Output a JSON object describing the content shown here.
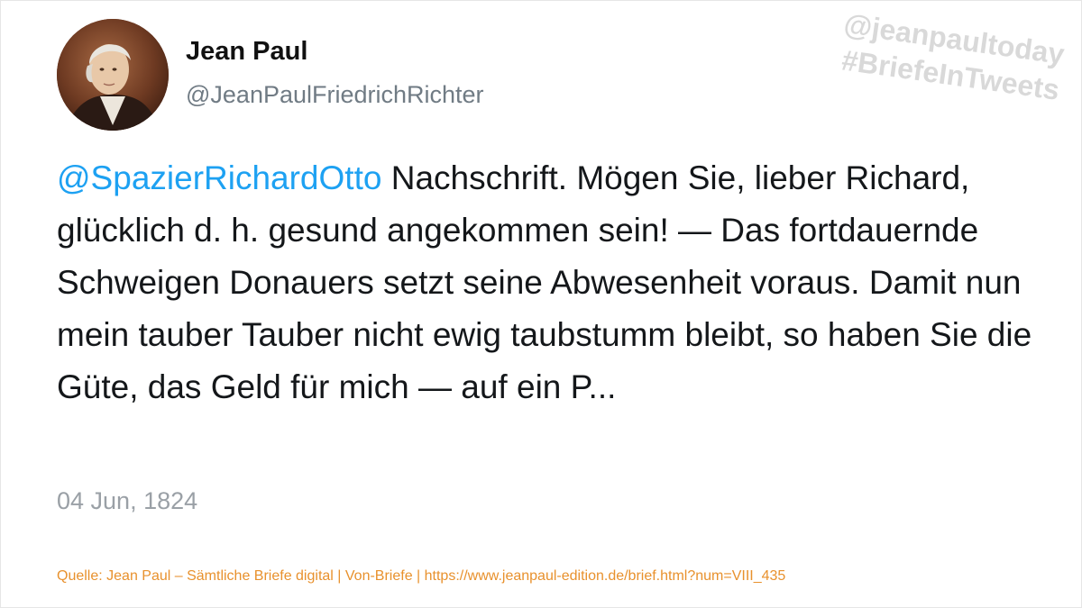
{
  "author": {
    "display_name": "Jean Paul",
    "handle": "@JeanPaulFriedrichRichter"
  },
  "watermark": {
    "line1": "@jeanpaultoday",
    "line2": "#BriefeInTweets"
  },
  "tweet": {
    "mention": "@SpazierRichardOtto",
    "text": " Nachschrift. Mögen Sie, lieber Richard, glücklich d. h. gesund angekommen sein! — Das fortdauernde Schweigen Donauers setzt seine Abwesenheit voraus. Damit nun mein tauber Tauber nicht ewig taubstumm bleibt, so haben Sie die Güte, das Geld für mich — auf ein P...",
    "date": "04 Jun, 1824"
  },
  "source": "Quelle: Jean Paul – Sämtliche Briefe digital | Von-Briefe | https://www.jeanpaul-edition.de/brief.html?num=VIII_435",
  "colors": {
    "mention": "#1da1f2",
    "source": "#e8912d",
    "watermark": "#d9d9d9"
  }
}
